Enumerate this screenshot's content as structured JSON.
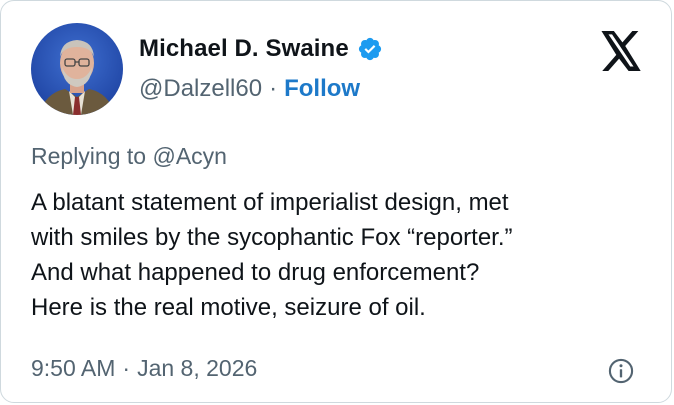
{
  "author": {
    "name": "Michael D. Swaine",
    "handle": "@Dalzell60",
    "separator": "·",
    "follow_label": "Follow",
    "verified_color": "#1d9bf0"
  },
  "reply": {
    "prefix": "Replying to ",
    "mention": "@Acyn"
  },
  "tweet": {
    "lines": [
      "A blatant statement of imperialist design, met",
      "with smiles by the sycophantic Fox “reporter.”",
      "And what happened to drug enforcement?",
      "Here is the real motive, seizure of oil."
    ]
  },
  "meta": {
    "time": "9:50 AM",
    "separator": "·",
    "date": "Jan 8, 2026"
  },
  "icons": {
    "logo": "x-logo-icon",
    "verified": "verified-badge-icon",
    "info": "info-icon"
  }
}
